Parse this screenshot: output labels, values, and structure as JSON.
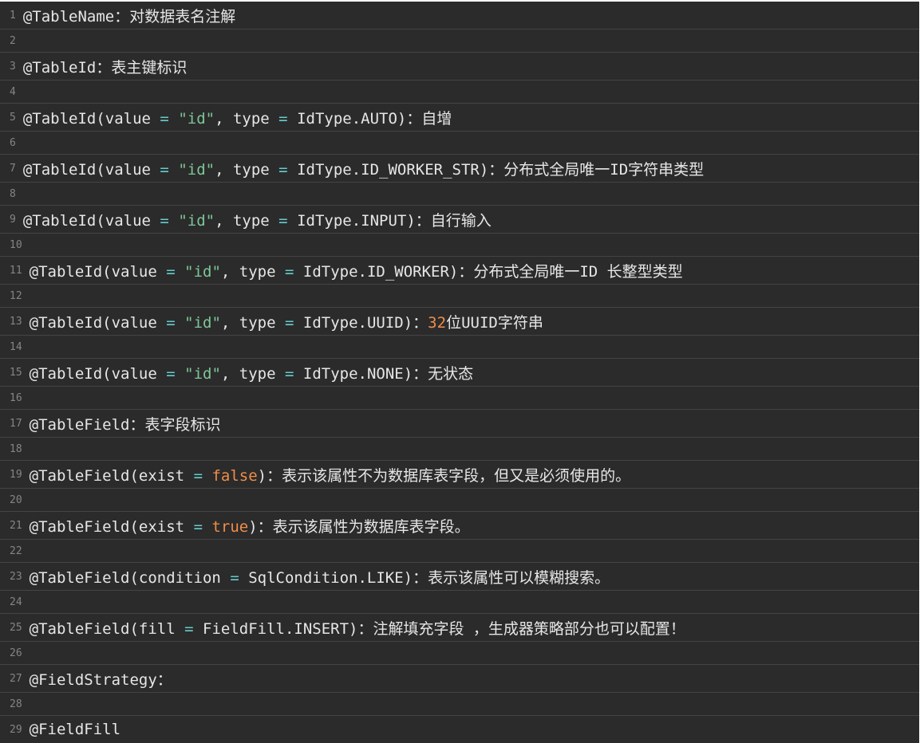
{
  "colors": {
    "background": "#2b2b2b",
    "text": "#e6e6e6",
    "line_number": "#858585",
    "string": "#7ec699",
    "number": "#f08d49",
    "operator": "#67cdcc",
    "divider": "#444444"
  },
  "lines": [
    {
      "n": "1",
      "tokens": [
        {
          "t": "@TableName：对数据表名注解",
          "k": "plain"
        }
      ]
    },
    {
      "n": "2",
      "tokens": []
    },
    {
      "n": "3",
      "tokens": [
        {
          "t": "@TableId：表主键标识",
          "k": "plain"
        }
      ]
    },
    {
      "n": "4",
      "tokens": []
    },
    {
      "n": "5",
      "tokens": [
        {
          "t": "@TableId(value ",
          "k": "plain"
        },
        {
          "t": "=",
          "k": "op"
        },
        {
          "t": " ",
          "k": "plain"
        },
        {
          "t": "\"id\"",
          "k": "str"
        },
        {
          "t": ", type ",
          "k": "plain"
        },
        {
          "t": "=",
          "k": "op"
        },
        {
          "t": " IdType.AUTO)：自增",
          "k": "plain"
        }
      ]
    },
    {
      "n": "6",
      "tokens": []
    },
    {
      "n": "7",
      "tokens": [
        {
          "t": "@TableId(value ",
          "k": "plain"
        },
        {
          "t": "=",
          "k": "op"
        },
        {
          "t": " ",
          "k": "plain"
        },
        {
          "t": "\"id\"",
          "k": "str"
        },
        {
          "t": ", type ",
          "k": "plain"
        },
        {
          "t": "=",
          "k": "op"
        },
        {
          "t": " IdType.ID_WORKER_STR)：分布式全局唯一ID字符串类型",
          "k": "plain"
        }
      ]
    },
    {
      "n": "8",
      "tokens": []
    },
    {
      "n": "9",
      "tokens": [
        {
          "t": "@TableId(value ",
          "k": "plain"
        },
        {
          "t": "=",
          "k": "op"
        },
        {
          "t": " ",
          "k": "plain"
        },
        {
          "t": "\"id\"",
          "k": "str"
        },
        {
          "t": ", type ",
          "k": "plain"
        },
        {
          "t": "=",
          "k": "op"
        },
        {
          "t": " IdType.INPUT)：自行输入",
          "k": "plain"
        }
      ]
    },
    {
      "n": "10",
      "tokens": []
    },
    {
      "n": "11",
      "tokens": [
        {
          "t": "@TableId(value ",
          "k": "plain"
        },
        {
          "t": "=",
          "k": "op"
        },
        {
          "t": " ",
          "k": "plain"
        },
        {
          "t": "\"id\"",
          "k": "str"
        },
        {
          "t": ", type ",
          "k": "plain"
        },
        {
          "t": "=",
          "k": "op"
        },
        {
          "t": " IdType.ID_WORKER)：分布式全局唯一ID 长整型类型",
          "k": "plain"
        }
      ]
    },
    {
      "n": "12",
      "tokens": []
    },
    {
      "n": "13",
      "tokens": [
        {
          "t": "@TableId(value ",
          "k": "plain"
        },
        {
          "t": "=",
          "k": "op"
        },
        {
          "t": " ",
          "k": "plain"
        },
        {
          "t": "\"id\"",
          "k": "str"
        },
        {
          "t": ", type ",
          "k": "plain"
        },
        {
          "t": "=",
          "k": "op"
        },
        {
          "t": " IdType.UUID)：",
          "k": "plain"
        },
        {
          "t": "32",
          "k": "num"
        },
        {
          "t": "位UUID字符串",
          "k": "plain"
        }
      ]
    },
    {
      "n": "14",
      "tokens": []
    },
    {
      "n": "15",
      "tokens": [
        {
          "t": "@TableId(value ",
          "k": "plain"
        },
        {
          "t": "=",
          "k": "op"
        },
        {
          "t": " ",
          "k": "plain"
        },
        {
          "t": "\"id\"",
          "k": "str"
        },
        {
          "t": ", type ",
          "k": "plain"
        },
        {
          "t": "=",
          "k": "op"
        },
        {
          "t": " IdType.NONE)：无状态",
          "k": "plain"
        }
      ]
    },
    {
      "n": "16",
      "tokens": []
    },
    {
      "n": "17",
      "tokens": [
        {
          "t": "@TableField：表字段标识",
          "k": "plain"
        }
      ]
    },
    {
      "n": "18",
      "tokens": []
    },
    {
      "n": "19",
      "tokens": [
        {
          "t": "@TableField(exist ",
          "k": "plain"
        },
        {
          "t": "=",
          "k": "op"
        },
        {
          "t": " ",
          "k": "plain"
        },
        {
          "t": "false",
          "k": "bool"
        },
        {
          "t": ")：表示该属性不为数据库表字段，但又是必须使用的。",
          "k": "plain"
        }
      ]
    },
    {
      "n": "20",
      "tokens": []
    },
    {
      "n": "21",
      "tokens": [
        {
          "t": "@TableField(exist ",
          "k": "plain"
        },
        {
          "t": "=",
          "k": "op"
        },
        {
          "t": " ",
          "k": "plain"
        },
        {
          "t": "true",
          "k": "bool"
        },
        {
          "t": ")：表示该属性为数据库表字段。",
          "k": "plain"
        }
      ]
    },
    {
      "n": "22",
      "tokens": []
    },
    {
      "n": "23",
      "tokens": [
        {
          "t": "@TableField(condition ",
          "k": "plain"
        },
        {
          "t": "=",
          "k": "op"
        },
        {
          "t": " SqlCondition.LIKE)：表示该属性可以模糊搜索。",
          "k": "plain"
        }
      ]
    },
    {
      "n": "24",
      "tokens": []
    },
    {
      "n": "25",
      "tokens": [
        {
          "t": "@TableField(fill ",
          "k": "plain"
        },
        {
          "t": "=",
          "k": "op"
        },
        {
          "t": " FieldFill.INSERT)：注解填充字段 ，生成器策略部分也可以配置！",
          "k": "plain"
        }
      ]
    },
    {
      "n": "26",
      "tokens": []
    },
    {
      "n": "27",
      "tokens": [
        {
          "t": "@FieldStrategy：",
          "k": "plain"
        }
      ]
    },
    {
      "n": "28",
      "tokens": []
    },
    {
      "n": "29",
      "tokens": [
        {
          "t": "@FieldFill",
          "k": "plain"
        }
      ]
    }
  ]
}
